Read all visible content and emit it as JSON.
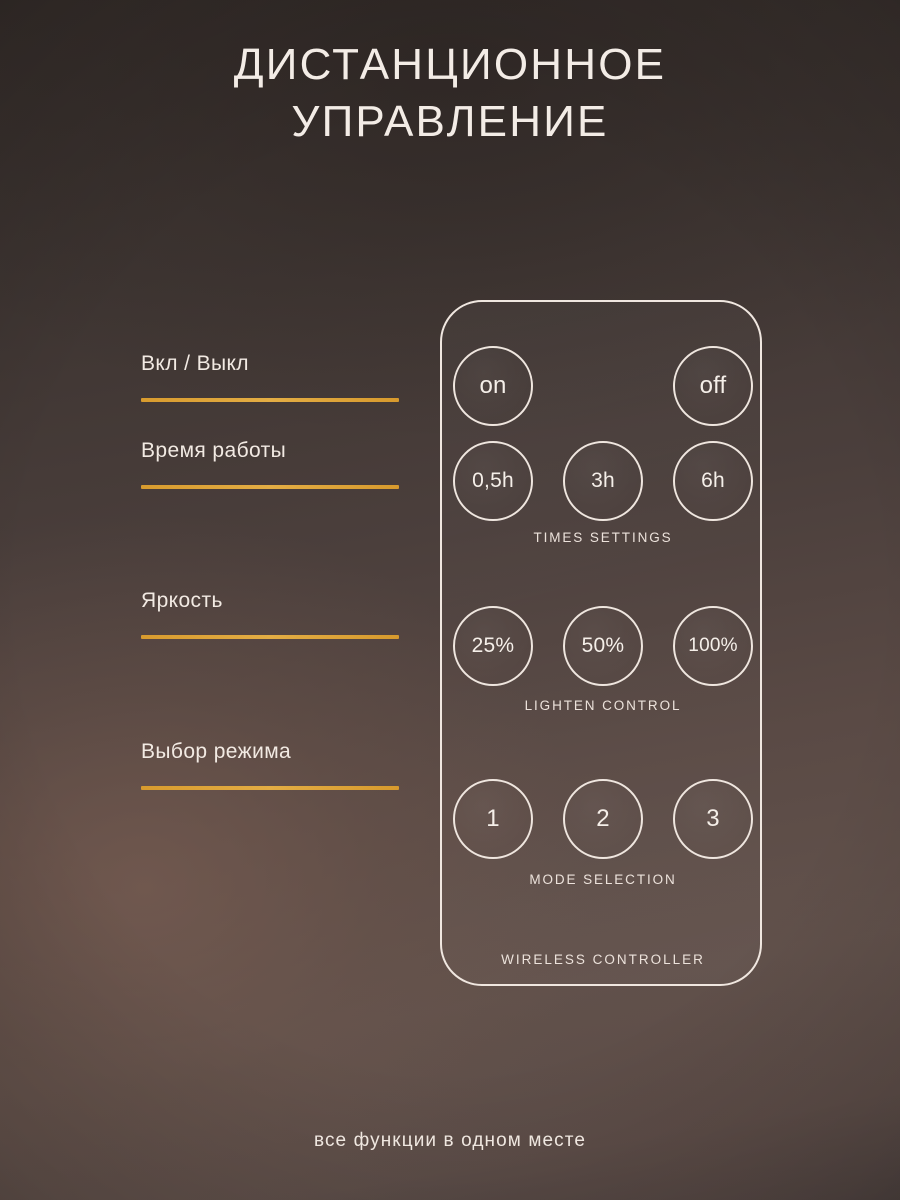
{
  "title": {
    "line1": "ДИСТАНЦИОННОЕ",
    "line2": "УПРАВЛЕНИЕ"
  },
  "features": [
    {
      "label": "Вкл / Выкл"
    },
    {
      "label": "Время работы"
    },
    {
      "label": "Яркость"
    },
    {
      "label": "Выбор режима"
    }
  ],
  "remote": {
    "power_row": [
      {
        "label": "on"
      },
      {
        "label": "off"
      }
    ],
    "timer_row": [
      {
        "label": "0,5h"
      },
      {
        "label": "3h"
      },
      {
        "label": "6h"
      }
    ],
    "timer_caption": "TIMES SETTINGS",
    "brightness_row": [
      {
        "label": "25%"
      },
      {
        "label": "50%"
      },
      {
        "label": "100%"
      }
    ],
    "brightness_caption": "LIGHTEN CONTROL",
    "mode_row": [
      {
        "label": "1"
      },
      {
        "label": "2"
      },
      {
        "label": "3"
      }
    ],
    "mode_caption": "MODE SELECTION",
    "device_caption": "WIRELESS CONTROLLER"
  },
  "tagline": "все функции в одном месте",
  "colors": {
    "accent_gold": "#E0A83C",
    "text_cream": "#F2EAE3",
    "background_dark": "#362E2B",
    "background_light": "#62524C"
  }
}
